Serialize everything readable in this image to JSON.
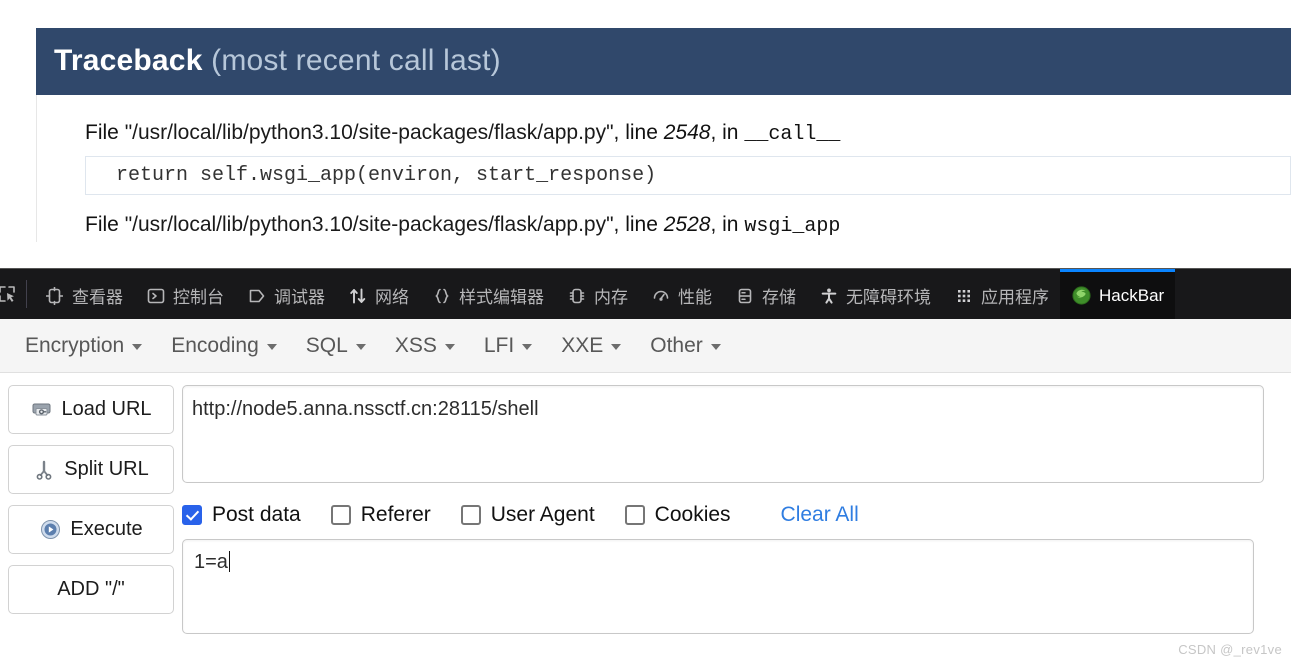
{
  "traceback": {
    "title": "Traceback",
    "subtitle": "(most recent call last)",
    "frames": [
      {
        "file_prefix": "File ",
        "path": "\"/usr/local/lib/python3.10/site-packages/flask/app.py\"",
        "line_label": ", line ",
        "line_number": "2548",
        "in_label": ", in ",
        "function": "__call__",
        "code": "return self.wsgi_app(environ, start_response)"
      },
      {
        "file_prefix": "File ",
        "path": "\"/usr/local/lib/python3.10/site-packages/flask/app.py\"",
        "line_label": ", line ",
        "line_number": "2528",
        "in_label": ", in ",
        "function": "wsgi_app",
        "code": ""
      }
    ]
  },
  "devtools": {
    "picker_icon": "element-picker-icon",
    "tabs": [
      {
        "label": "查看器",
        "icon": "inspector-icon",
        "active": false
      },
      {
        "label": "控制台",
        "icon": "console-icon",
        "active": false
      },
      {
        "label": "调试器",
        "icon": "debugger-icon",
        "active": false
      },
      {
        "label": "网络",
        "icon": "network-icon",
        "active": false
      },
      {
        "label": "样式编辑器",
        "icon": "style-editor-icon",
        "active": false
      },
      {
        "label": "内存",
        "icon": "memory-icon",
        "active": false
      },
      {
        "label": "性能",
        "icon": "performance-icon",
        "active": false
      },
      {
        "label": "存储",
        "icon": "storage-icon",
        "active": false
      },
      {
        "label": "无障碍环境",
        "icon": "accessibility-icon",
        "active": false
      },
      {
        "label": "应用程序",
        "icon": "application-icon",
        "active": false
      },
      {
        "label": "HackBar",
        "icon": "hackbar-icon",
        "active": true
      }
    ],
    "active_tab_accent": "#0a84ff",
    "toolbar_bg": "#18181a"
  },
  "hackbar": {
    "menus": [
      {
        "label": "Encryption"
      },
      {
        "label": "Encoding"
      },
      {
        "label": "SQL"
      },
      {
        "label": "XSS"
      },
      {
        "label": "LFI"
      },
      {
        "label": "XXE"
      },
      {
        "label": "Other"
      }
    ],
    "buttons": [
      {
        "label": "Load URL",
        "icon": "load-url-icon"
      },
      {
        "label": "Split URL",
        "icon": "scissors-icon"
      },
      {
        "label": "Execute",
        "icon": "play-icon"
      },
      {
        "label": "ADD \"/\"",
        "icon": ""
      }
    ],
    "url_value": "http://node5.anna.nssctf.cn:28115/shell",
    "url_placeholder": "",
    "options": [
      {
        "label": "Post data",
        "checked": true
      },
      {
        "label": "Referer",
        "checked": false
      },
      {
        "label": "User Agent",
        "checked": false
      },
      {
        "label": "Cookies",
        "checked": false
      }
    ],
    "clear_all_label": "Clear All",
    "clear_all_color": "#2f7de1",
    "post_data_value": "1=a",
    "post_data_placeholder": ""
  },
  "watermark": {
    "text": "CSDN @_rev1ve"
  }
}
